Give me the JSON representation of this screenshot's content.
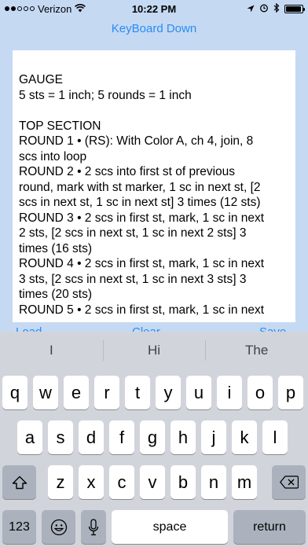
{
  "status_bar": {
    "carrier": "Verizon",
    "time": "10:22 PM",
    "signal_bars_filled": 2,
    "signal_bars_total": 5,
    "icons": [
      "wifi-icon",
      "location-icon",
      "alarm-icon",
      "bluetooth-icon",
      "battery-icon"
    ],
    "battery_level": 0.95
  },
  "top_action": {
    "label": "KeyBoard Down"
  },
  "text_view": {
    "lines": [
      "GAUGE",
      "5 sts = 1 inch; 5 rounds = 1 inch",
      "",
      "TOP SECTION",
      "ROUND 1 • (RS): With Color A, ch 4, join, 8",
      "scs into loop",
      "ROUND 2 • 2 scs into first st of previous",
      "round, mark with st marker, 1 sc in next st, [2",
      "scs in next st, 1 sc in next st] 3 times (12 sts)",
      "ROUND 3 • 2 scs in first st, mark, 1 sc in next",
      "2 sts, [2 scs in next st, 1 sc in next 2 sts] 3",
      "times (16 sts)",
      "ROUND 4 • 2 scs in first st, mark, 1 sc in next",
      "3 sts, [2 scs in next st, 1 sc in next 3 sts] 3",
      "times (20 sts)",
      "ROUND 5 • 2 scs in first st, mark, 1 sc in next"
    ]
  },
  "keyboard": {
    "predictions": [
      "I",
      "Hi",
      "The"
    ],
    "row1": [
      "q",
      "w",
      "e",
      "r",
      "t",
      "y",
      "u",
      "i",
      "o",
      "p"
    ],
    "row2": [
      "a",
      "s",
      "d",
      "f",
      "g",
      "h",
      "j",
      "k",
      "l"
    ],
    "row3": [
      "z",
      "x",
      "c",
      "v",
      "b",
      "n",
      "m"
    ],
    "numbers_label": "123",
    "space_label": "space",
    "return_label": "return",
    "shift_icon": "shift-icon",
    "delete_icon": "delete-icon",
    "emoji_icon": "emoji-icon",
    "mic_icon": "microphone-icon"
  },
  "colors": {
    "background": "#c5d9f3",
    "accent": "#2a8cf2",
    "keyboard_bg": "#d1d5db",
    "key_light": "#ffffff",
    "key_dark": "#abb2bd"
  }
}
